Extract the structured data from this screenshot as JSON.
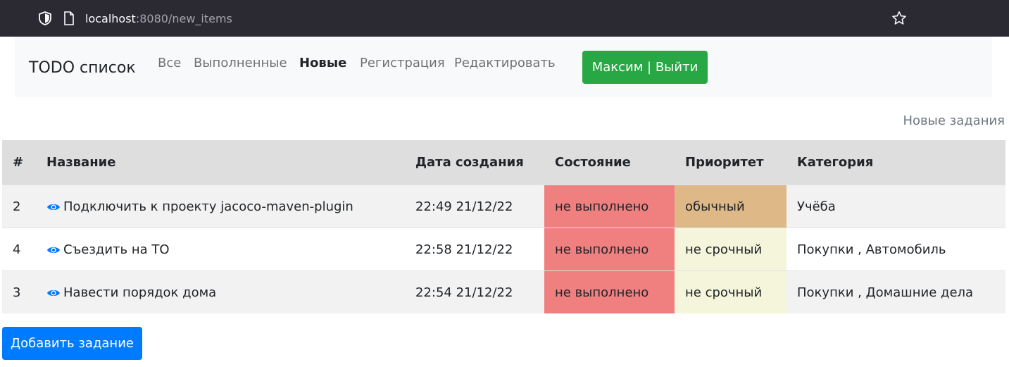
{
  "browser": {
    "url_host": "localhost",
    "url_rest": ":8080/new_items"
  },
  "navbar": {
    "brand": "TODO список",
    "links": [
      "Все",
      "Выполненные",
      "Новые",
      "Регистрация",
      "Редактировать"
    ],
    "active_link": "Новые",
    "user_button": "Максим | Выйти"
  },
  "section_caption": "Новые задания",
  "table": {
    "headers": [
      "#",
      "Название",
      "Дата создания",
      "Состояние",
      "Приоритет",
      "Категория"
    ],
    "rows": [
      {
        "id": "2",
        "name": "Подключить к проекту jacoco-maven-plugin",
        "created": "22:49 21/12/22",
        "state": "не выполнено",
        "priority": "обычный",
        "category": "Учёба"
      },
      {
        "id": "4",
        "name": "Съездить на ТО",
        "created": "22:58 21/12/22",
        "state": "не выполнено",
        "priority": "не срочный",
        "category": "Покупки , Автомобиль"
      },
      {
        "id": "3",
        "name": "Навести порядок дома",
        "created": "22:54 21/12/22",
        "state": "не выполнено",
        "priority": "не срочный",
        "category": "Покупки , Домашние дела"
      }
    ]
  },
  "add_button": "Добавить задание",
  "colors": {
    "state_not_done": "#f08080",
    "priority_normal": "#deb887",
    "priority_low": "#f5f5dc",
    "user_button": "#28a745",
    "add_button": "#007bff",
    "eye_icon": "#007bff"
  },
  "icons": [
    "shield-icon",
    "page-icon",
    "star-icon",
    "eye-icon"
  ]
}
